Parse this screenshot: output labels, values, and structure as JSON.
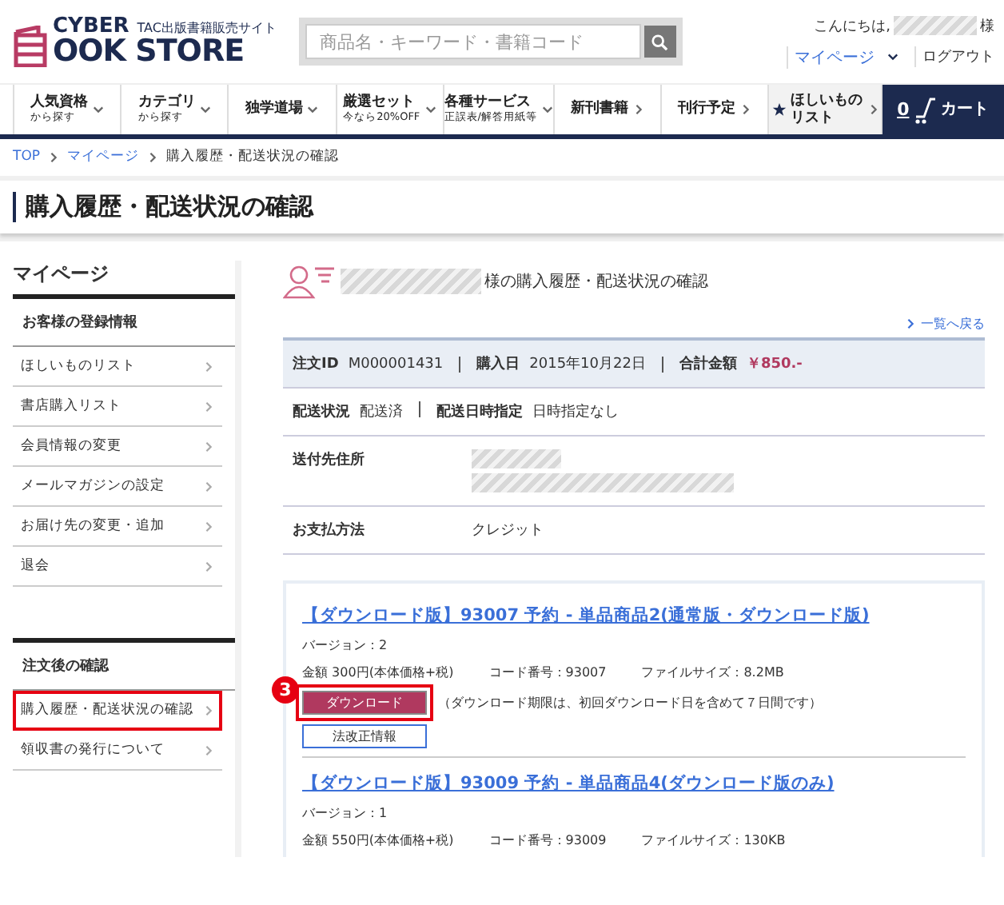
{
  "header": {
    "logo": {
      "top": "CYBER",
      "tagline": "TAC出版書籍販売サイト",
      "main": "OOK STORE"
    },
    "search": {
      "placeholder": "商品名・キーワード・書籍コード"
    },
    "greeting": {
      "prefix": "こんにちは,",
      "suffix": "様"
    },
    "mypage": "マイページ",
    "logout": "ログアウト"
  },
  "nav": [
    {
      "kind": "dropdown",
      "title": "人気資格",
      "sub": "から探す"
    },
    {
      "kind": "dropdown",
      "title": "カテゴリ",
      "sub": "から探す"
    },
    {
      "kind": "dropdown",
      "title": "独学道場"
    },
    {
      "kind": "dropdown",
      "title": "厳選セット",
      "sub": "今なら20%OFF"
    },
    {
      "kind": "dropdown",
      "title": "各種サービス",
      "sub": "正誤表/解答用紙等"
    },
    {
      "kind": "link",
      "title": "新刊書籍"
    },
    {
      "kind": "link",
      "title": "刊行予定"
    },
    {
      "kind": "wishlist",
      "title": "ほしいもの",
      "sub": "リスト"
    },
    {
      "kind": "cart",
      "count": "0",
      "title": "カート"
    }
  ],
  "breadcrumb": [
    {
      "label": "TOP",
      "link": true
    },
    {
      "label": "マイページ",
      "link": true
    },
    {
      "label": "購入履歴・配送状況の確認",
      "link": false
    }
  ],
  "page_title": "購入履歴・配送状況の確認",
  "sidebar": {
    "title": "マイページ",
    "sections": [
      {
        "heading": "お客様の登録情報",
        "items": [
          {
            "label": "ほしいものリスト",
            "highlighted": false
          },
          {
            "label": "書店購入リスト",
            "highlighted": false
          },
          {
            "label": "会員情報の変更",
            "highlighted": false
          },
          {
            "label": "メールマガジンの設定",
            "highlighted": false
          },
          {
            "label": "お届け先の変更・追加",
            "highlighted": false
          },
          {
            "label": "退会",
            "highlighted": false
          }
        ]
      },
      {
        "heading": "注文後の確認",
        "items": [
          {
            "label": "購入履歴・配送状況の確認",
            "highlighted": true
          },
          {
            "label": "領収書の発行について",
            "highlighted": false
          }
        ]
      }
    ]
  },
  "main": {
    "heading_suffix": "様の購入履歴・配送状況の確認",
    "back_link": "一覧へ戻る",
    "summary": [
      {
        "label": "注文ID",
        "value": "M000001431",
        "kind": "text"
      },
      {
        "label": "購入日",
        "value": "2015年10月22日",
        "kind": "text"
      },
      {
        "label": "合計金額",
        "value": "￥850.-",
        "kind": "price"
      }
    ],
    "shipping": [
      {
        "label": "配送状況",
        "value": "配送済"
      },
      {
        "label": "配送日時指定",
        "value": "日時指定なし"
      }
    ],
    "details": [
      {
        "label": "送付先住所",
        "kind": "redacted"
      },
      {
        "label": "お支払方法",
        "kind": "text",
        "value": "クレジット"
      }
    ],
    "products": [
      {
        "title": "【ダウンロード版】93007 予約 - 単品商品2(通常版・ダウンロード版)",
        "version": "バージョン：2",
        "price": "金額 300円(本体価格+税)",
        "code": "コード番号：93007",
        "size": "ファイルサイズ：8.2MB",
        "download": {
          "label": "ダウンロード",
          "note": "（ダウンロード期限は、初回ダウンロード日を含めて７日間です）",
          "highlighted": true,
          "callout": "3"
        },
        "info_button": "法改正情報"
      },
      {
        "title": "【ダウンロード版】93009 予約 - 単品商品4(ダウンロード版のみ)",
        "version": "バージョン：1",
        "price": "金額 550円(本体価格+税)",
        "code": "コード番号：93009",
        "size": "ファイルサイズ：130KB"
      }
    ]
  }
}
